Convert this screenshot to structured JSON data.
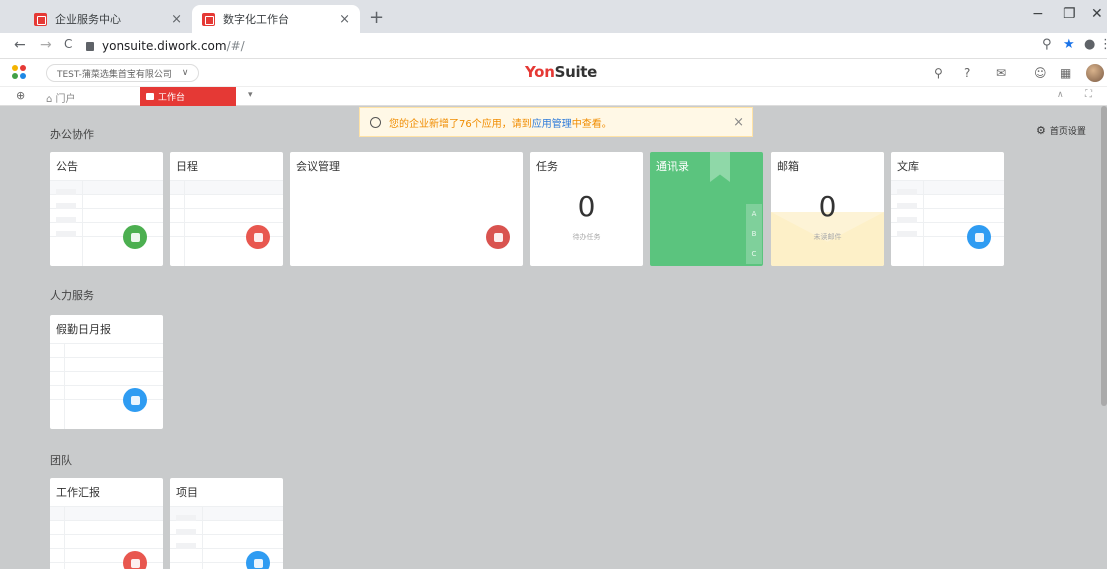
{
  "browser": {
    "tabs": [
      {
        "title": "企业服务中心",
        "active": false
      },
      {
        "title": "数字化工作台",
        "active": true
      }
    ],
    "new_tab": "+",
    "window_controls": {
      "minimize": "−",
      "restore": "❐",
      "close": "✕"
    },
    "tab_close": "×"
  },
  "address_bar": {
    "back": "←",
    "forward": "→",
    "reload": "C",
    "url_host": "yonsuite.diwork.com",
    "url_path": "/#/",
    "icons": {
      "zoom": "⚲",
      "bookmark": "★",
      "profile": "●",
      "menu": "⋮"
    }
  },
  "app_header": {
    "tenant": "TEST-蒲菜选集首宝有限公司",
    "tenant_chevron": "∨",
    "brand_main": "Yon",
    "brand_suffix": "Suite",
    "icons": {
      "search": "⚲",
      "help": "?",
      "message": "✉",
      "service": "☺",
      "calendar": "▦"
    }
  },
  "workspace_tabs": {
    "pin": "⊕",
    "home_label": "⌂ 门户",
    "active_label": "工作台",
    "dropdown": "▾",
    "collapse": "∧",
    "fullscreen": "⛶"
  },
  "notice": {
    "text_prefix": "您的企业新增了76个应用，请到",
    "link": "应用管理",
    "text_suffix": "中查看。",
    "close": "×"
  },
  "settings_label": "首页设置",
  "sections": [
    {
      "title": "办公协作"
    },
    {
      "title": "人力服务"
    },
    {
      "title": "团队"
    }
  ],
  "cards": {
    "announcement": {
      "title": "公告"
    },
    "schedule": {
      "title": "日程"
    },
    "meeting": {
      "title": "会议管理"
    },
    "tasks": {
      "title": "任务",
      "count": "0",
      "sublabel": "待办任务"
    },
    "contacts": {
      "title": "通讯录",
      "letters": [
        "A",
        "B",
        "C"
      ]
    },
    "mail": {
      "title": "邮箱",
      "count": "0",
      "sublabel": "未读邮件"
    },
    "library": {
      "title": "文库"
    },
    "attendance": {
      "title": "假勤日月报"
    },
    "work_report": {
      "title": "工作汇报"
    },
    "project": {
      "title": "项目"
    }
  },
  "colors": {
    "brand_red": "#e53935",
    "green": "#4caf50",
    "contacts_green": "#5bc47e",
    "blue": "#2f9cf2",
    "mail_yellow": "#fdf3d6"
  }
}
